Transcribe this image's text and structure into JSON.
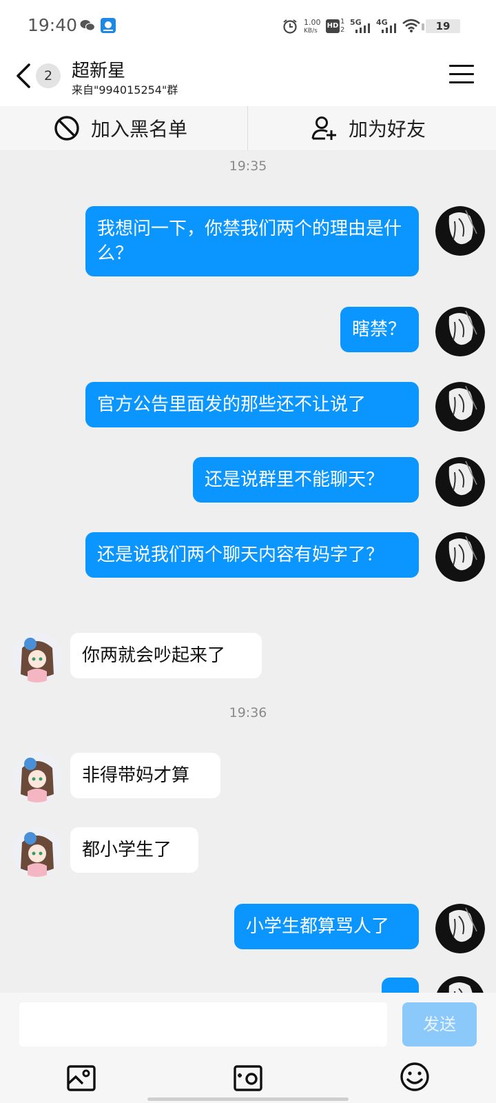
{
  "status_bar": {
    "time": "19:40",
    "net_speed_value": "1.00",
    "net_speed_unit": "KB/s",
    "sim1_type": "5G",
    "sim2_type": "4G",
    "hd_label": "HD",
    "hd_sub_top": "1",
    "hd_sub_bottom": "2",
    "battery_level": "19"
  },
  "header": {
    "title": "超新星",
    "subtitle": "来自\"994015254\"群",
    "unread_count": "2"
  },
  "actions": {
    "blacklist_label": "加入黑名单",
    "add_friend_label": "加为好友"
  },
  "messages": {
    "time_1": "19:35",
    "time_2": "19:36",
    "m1": "我想问一下，你禁我们两个的理由是什么？",
    "m2": "瞎禁？",
    "m3": "官方公告里面发的那些还不让说了",
    "m4": "还是说群里不能聊天？",
    "m5": "还是说我们两个聊天内容有妈字了？",
    "m6": "你两就会吵起来了",
    "m7": "非得带妈才算",
    "m8": "都小学生了",
    "m9": "小学生都算骂人了"
  },
  "input": {
    "placeholder": "",
    "send_label": "发送"
  },
  "colors": {
    "outgoing_bubble": "#0a95ff",
    "incoming_bubble": "#ffffff",
    "send_button_disabled": "#8cc9fb",
    "chat_background": "#efefef"
  },
  "icons": {
    "back": "chevron-left-icon",
    "menu": "menu-icon",
    "blacklist": "block-icon",
    "add_friend": "add-person-icon",
    "image": "image-icon",
    "camera": "camera-icon",
    "emoji": "emoji-icon"
  }
}
